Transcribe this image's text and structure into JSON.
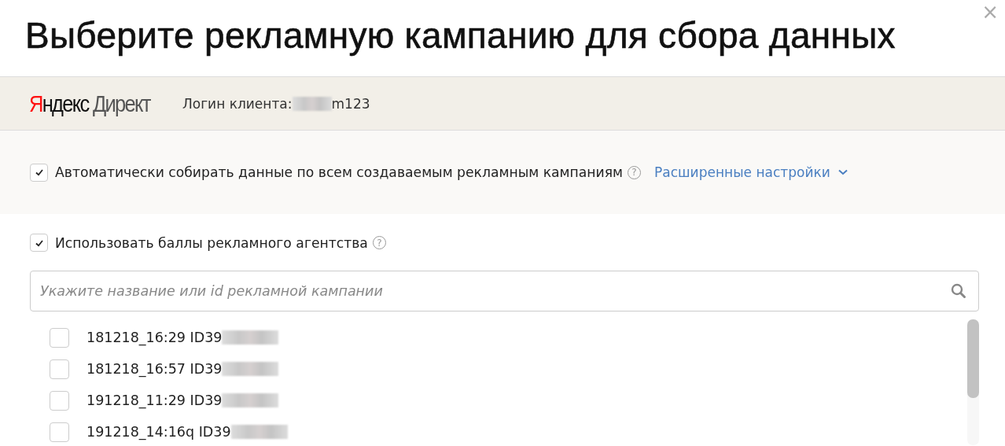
{
  "dialog": {
    "title": "Выберите рекламную кампанию для сбора данных",
    "close": "×"
  },
  "account": {
    "logo": {
      "brand": "Яндекс",
      "product": "Директ"
    },
    "login_label": "Логин клиента:",
    "login_redacted": true,
    "login_suffix": "m123"
  },
  "auto_collect": {
    "label": "Автоматически собирать данные по всем создаваемым рекламным кампаниям",
    "checked": true,
    "help": "?",
    "link": "Расширенные настройки",
    "expanded": false
  },
  "agency_points": {
    "label": "Использовать баллы рекламного агентства",
    "checked": true,
    "help": "?"
  },
  "search": {
    "placeholder": "Укажите название или id рекламной кампании"
  },
  "campaigns": [
    {
      "name": "181218_16:29 ID39",
      "redacted": true,
      "checked": false
    },
    {
      "name": "181218_16:57 ID39",
      "redacted": true,
      "checked": false
    },
    {
      "name": "191218_11:29 ID39",
      "redacted": true,
      "checked": false
    },
    {
      "name": "191218_14:16q ID39",
      "redacted": true,
      "checked": false
    }
  ]
}
